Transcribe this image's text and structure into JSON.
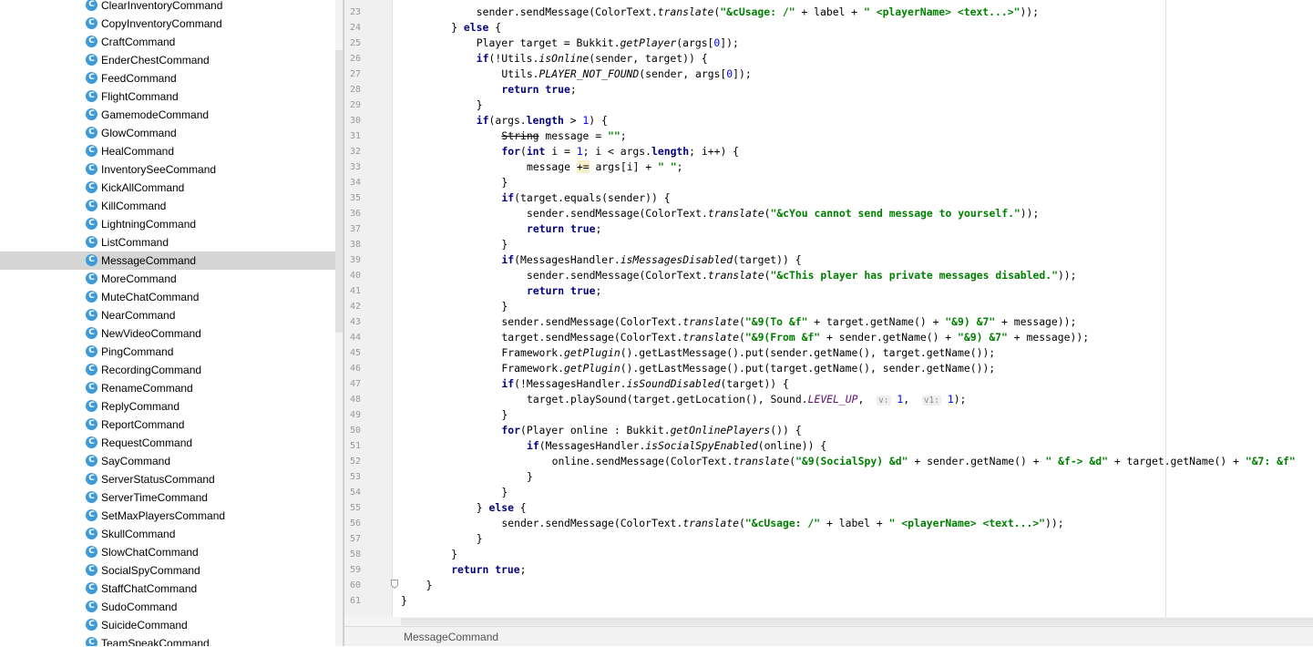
{
  "project_tree": {
    "items": [
      {
        "label": "ClearInventoryCommand"
      },
      {
        "label": "CopyInventoryCommand"
      },
      {
        "label": "CraftCommand"
      },
      {
        "label": "EnderChestCommand"
      },
      {
        "label": "FeedCommand"
      },
      {
        "label": "FlightCommand"
      },
      {
        "label": "GamemodeCommand"
      },
      {
        "label": "GlowCommand"
      },
      {
        "label": "HealCommand"
      },
      {
        "label": "InventorySeeCommand"
      },
      {
        "label": "KickAllCommand"
      },
      {
        "label": "KillCommand"
      },
      {
        "label": "LightningCommand"
      },
      {
        "label": "ListCommand"
      },
      {
        "label": "MessageCommand",
        "selected": true
      },
      {
        "label": "MoreCommand"
      },
      {
        "label": "MuteChatCommand"
      },
      {
        "label": "NearCommand"
      },
      {
        "label": "NewVideoCommand"
      },
      {
        "label": "PingCommand"
      },
      {
        "label": "RecordingCommand"
      },
      {
        "label": "RenameCommand"
      },
      {
        "label": "ReplyCommand"
      },
      {
        "label": "ReportCommand"
      },
      {
        "label": "RequestCommand"
      },
      {
        "label": "SayCommand"
      },
      {
        "label": "ServerStatusCommand"
      },
      {
        "label": "ServerTimeCommand"
      },
      {
        "label": "SetMaxPlayersCommand"
      },
      {
        "label": "SkullCommand"
      },
      {
        "label": "SlowChatCommand"
      },
      {
        "label": "SocialSpyCommand"
      },
      {
        "label": "StaffChatCommand"
      },
      {
        "label": "SudoCommand"
      },
      {
        "label": "SuicideCommand"
      },
      {
        "label": "TeamSpeakCommand"
      }
    ],
    "class_icon_glyph": "C",
    "class_icon_color": "#3e9bd8"
  },
  "editor": {
    "first_line_number": 23,
    "line_numbers": [
      "23",
      "24",
      "25",
      "26",
      "27",
      "28",
      "29",
      "30",
      "31",
      "32",
      "33",
      "34",
      "35",
      "36",
      "37",
      "38",
      "39",
      "40",
      "41",
      "42",
      "43",
      "44",
      "45",
      "46",
      "47",
      "48",
      "49",
      "50",
      "51",
      "52",
      "53",
      "54",
      "55",
      "56",
      "57",
      "58",
      "59",
      "60",
      "61"
    ],
    "code_lines": [
      [
        {
          "t": "sender.sendMessage(ColorText."
        },
        {
          "t": "translate",
          "c": "st"
        },
        {
          "t": "("
        },
        {
          "t": "\"&cUsage: /\"",
          "c": "str"
        },
        {
          "t": " + label + "
        },
        {
          "t": "\" <playerName> <text...>\"",
          "c": "str"
        },
        {
          "t": "));"
        }
      ],
      [
        {
          "t": "} "
        },
        {
          "t": "else",
          "c": "kw"
        },
        {
          "t": " {"
        }
      ],
      [
        {
          "t": "Player target = Bukkit."
        },
        {
          "t": "getPlayer",
          "c": "st"
        },
        {
          "t": "(args["
        },
        {
          "t": "0",
          "c": "num"
        },
        {
          "t": "]);"
        }
      ],
      [
        {
          "t": "if",
          "c": "kw"
        },
        {
          "t": "(!Utils."
        },
        {
          "t": "isOnline",
          "c": "st"
        },
        {
          "t": "(sender, target)) {"
        }
      ],
      [
        {
          "t": "Utils."
        },
        {
          "t": "PLAYER_NOT_FOUND",
          "c": "st"
        },
        {
          "t": "(sender, args["
        },
        {
          "t": "0",
          "c": "num"
        },
        {
          "t": "]);"
        }
      ],
      [
        {
          "t": "return true",
          "c": "kw"
        },
        {
          "t": ";"
        }
      ],
      [
        {
          "t": "}"
        }
      ],
      [
        {
          "t": "if",
          "c": "kw"
        },
        {
          "t": "(args."
        },
        {
          "t": "length",
          "c": "kw"
        },
        {
          "t": " > "
        },
        {
          "t": "1",
          "c": "num"
        },
        {
          "t": ") {"
        }
      ],
      [
        {
          "t": "String",
          "c": "strike"
        },
        {
          "t": " message = "
        },
        {
          "t": "\"\"",
          "c": "str"
        },
        {
          "t": ";"
        }
      ],
      [
        {
          "t": "for",
          "c": "kw"
        },
        {
          "t": "("
        },
        {
          "t": "int",
          "c": "kw"
        },
        {
          "t": " i = "
        },
        {
          "t": "1",
          "c": "num"
        },
        {
          "t": "; i < args."
        },
        {
          "t": "length",
          "c": "kw"
        },
        {
          "t": "; i++) {"
        }
      ],
      [
        {
          "t": "message "
        },
        {
          "t": "+=",
          "c": "hl"
        },
        {
          "t": " args[i] + "
        },
        {
          "t": "\" \"",
          "c": "str"
        },
        {
          "t": ";"
        }
      ],
      [
        {
          "t": "}"
        }
      ],
      [
        {
          "t": "if",
          "c": "kw"
        },
        {
          "t": "(target.equals(sender)) {"
        }
      ],
      [
        {
          "t": "sender.sendMessage(ColorText."
        },
        {
          "t": "translate",
          "c": "st"
        },
        {
          "t": "("
        },
        {
          "t": "\"&cYou cannot send message to yourself.\"",
          "c": "str"
        },
        {
          "t": "));"
        }
      ],
      [
        {
          "t": "return true",
          "c": "kw"
        },
        {
          "t": ";"
        }
      ],
      [
        {
          "t": "}"
        }
      ],
      [
        {
          "t": "if",
          "c": "kw"
        },
        {
          "t": "(MessagesHandler."
        },
        {
          "t": "isMessagesDisabled",
          "c": "st"
        },
        {
          "t": "(target)) {"
        }
      ],
      [
        {
          "t": "sender.sendMessage(ColorText."
        },
        {
          "t": "translate",
          "c": "st"
        },
        {
          "t": "("
        },
        {
          "t": "\"&cThis player has private messages disabled.\"",
          "c": "str"
        },
        {
          "t": "));"
        }
      ],
      [
        {
          "t": "return true",
          "c": "kw"
        },
        {
          "t": ";"
        }
      ],
      [
        {
          "t": "}"
        }
      ],
      [
        {
          "t": "sender.sendMessage(ColorText."
        },
        {
          "t": "translate",
          "c": "st"
        },
        {
          "t": "("
        },
        {
          "t": "\"&9(To &f\"",
          "c": "str"
        },
        {
          "t": " + target.getName() + "
        },
        {
          "t": "\"&9) &7\"",
          "c": "str"
        },
        {
          "t": " + message));"
        }
      ],
      [
        {
          "t": "target.sendMessage(ColorText."
        },
        {
          "t": "translate",
          "c": "st"
        },
        {
          "t": "("
        },
        {
          "t": "\"&9(From &f\"",
          "c": "str"
        },
        {
          "t": " + sender.getName() + "
        },
        {
          "t": "\"&9) &7\"",
          "c": "str"
        },
        {
          "t": " + message));"
        }
      ],
      [
        {
          "t": "Framework."
        },
        {
          "t": "getPlugin",
          "c": "st"
        },
        {
          "t": "().getLastMessage().put(sender.getName(), target.getName());"
        }
      ],
      [
        {
          "t": "Framework."
        },
        {
          "t": "getPlugin",
          "c": "st"
        },
        {
          "t": "().getLastMessage().put(target.getName(), sender.getName());"
        }
      ],
      [
        {
          "t": "if",
          "c": "kw"
        },
        {
          "t": "(!MessagesHandler."
        },
        {
          "t": "isSoundDisabled",
          "c": "st"
        },
        {
          "t": "(target)) {"
        }
      ],
      [
        {
          "t": "target.playSound(target.getLocation(), Sound."
        },
        {
          "t": "LEVEL_UP",
          "c": "sti"
        },
        {
          "t": ",  "
        },
        {
          "t": "v:",
          "c": "hint"
        },
        {
          "t": " "
        },
        {
          "t": "1",
          "c": "num"
        },
        {
          "t": ",  "
        },
        {
          "t": "v1:",
          "c": "hint"
        },
        {
          "t": " "
        },
        {
          "t": "1",
          "c": "num"
        },
        {
          "t": ");"
        }
      ],
      [
        {
          "t": "}"
        }
      ],
      [
        {
          "t": "for",
          "c": "kw"
        },
        {
          "t": "(Player online : Bukkit."
        },
        {
          "t": "getOnlinePlayers",
          "c": "st"
        },
        {
          "t": "()) {"
        }
      ],
      [
        {
          "t": "if",
          "c": "kw"
        },
        {
          "t": "(MessagesHandler."
        },
        {
          "t": "isSocialSpyEnabled",
          "c": "st"
        },
        {
          "t": "(online)) {"
        }
      ],
      [
        {
          "t": "online.sendMessage(ColorText."
        },
        {
          "t": "translate",
          "c": "st"
        },
        {
          "t": "("
        },
        {
          "t": "\"&9(SocialSpy) &d\"",
          "c": "str"
        },
        {
          "t": " + sender.getName() + "
        },
        {
          "t": "\" &f-> &d\"",
          "c": "str"
        },
        {
          "t": " + target.getName() + "
        },
        {
          "t": "\"&7: &f\"",
          "c": "str"
        }
      ],
      [
        {
          "t": "}"
        }
      ],
      [
        {
          "t": "}"
        }
      ],
      [
        {
          "t": "} "
        },
        {
          "t": "else",
          "c": "kw"
        },
        {
          "t": " {"
        }
      ],
      [
        {
          "t": "sender.sendMessage(ColorText."
        },
        {
          "t": "translate",
          "c": "st"
        },
        {
          "t": "("
        },
        {
          "t": "\"&cUsage: /\"",
          "c": "str"
        },
        {
          "t": " + label + "
        },
        {
          "t": "\" <playerName> <text...>\"",
          "c": "str"
        },
        {
          "t": "));"
        }
      ],
      [
        {
          "t": "}"
        }
      ],
      [
        {
          "t": "}"
        }
      ],
      [
        {
          "t": "return true",
          "c": "kw"
        },
        {
          "t": ";"
        }
      ],
      [
        {
          "t": "}"
        }
      ],
      [
        {
          "t": "}"
        }
      ]
    ]
  },
  "status_bar": {
    "breadcrumb": "MessageCommand"
  }
}
